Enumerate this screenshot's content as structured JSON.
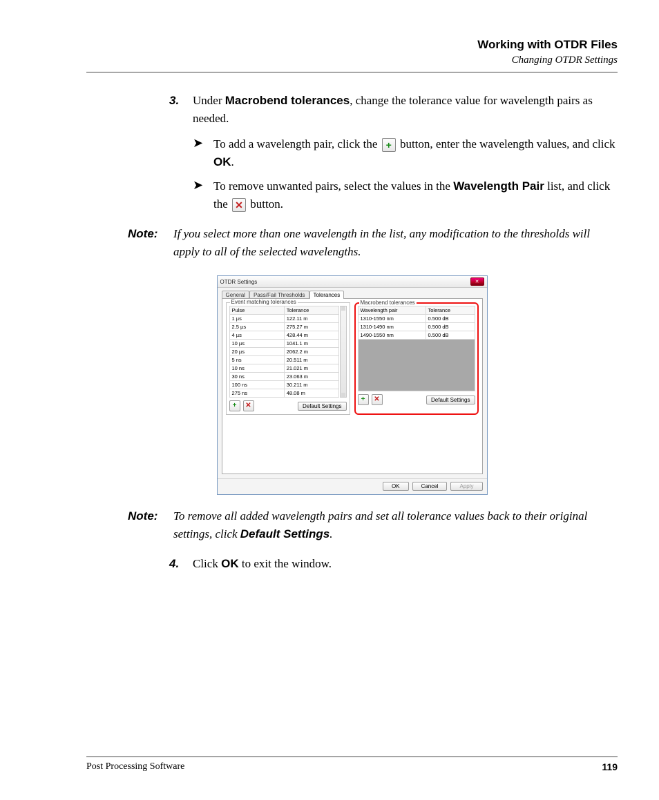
{
  "header": {
    "chapter": "Working with OTDR Files",
    "section": "Changing OTDR Settings"
  },
  "step3": {
    "num": "3.",
    "pre": "Under ",
    "bold1": "Macrobend tolerances",
    "post": ", change the tolerance value for wavelength pairs as needed."
  },
  "bullet1": {
    "a": "To add a wavelength pair, click the ",
    "b": " button, enter the wavelength values, and click ",
    "ok": "OK",
    "c": "."
  },
  "bullet2": {
    "a": "To remove unwanted pairs, select the values in the ",
    "wp": "Wavelength Pair",
    "b": " list, and click the ",
    "c": " button."
  },
  "note1": {
    "label": "Note:",
    "text": "If you select more than one wavelength in the list, any modification to the thresholds will apply to all of the selected wavelengths."
  },
  "dialog": {
    "title": "OTDR Settings",
    "tabs": {
      "general": "General",
      "passfail": "Pass/Fail Thresholds",
      "tolerances": "Tolerances"
    },
    "group1": {
      "title": "Event matching tolerances",
      "col1": "Pulse",
      "col2": "Tolerance",
      "rows": [
        {
          "pulse": "1 µs",
          "tol": "122.11 m"
        },
        {
          "pulse": "2.5 µs",
          "tol": "275.27 m"
        },
        {
          "pulse": "4 µs",
          "tol": "428.44 m"
        },
        {
          "pulse": "10 µs",
          "tol": "1041.1 m"
        },
        {
          "pulse": "20 µs",
          "tol": "2062.2 m"
        },
        {
          "pulse": "5 ns",
          "tol": "20.511 m"
        },
        {
          "pulse": "10 ns",
          "tol": "21.021 m"
        },
        {
          "pulse": "30 ns",
          "tol": "23.063 m"
        },
        {
          "pulse": "100 ns",
          "tol": "30.211 m"
        },
        {
          "pulse": "275 ns",
          "tol": "48.08 m"
        }
      ],
      "defaults": "Default Settings"
    },
    "group2": {
      "title": "Macrobend tolerances",
      "col1": "Wavelength pair",
      "col2": "Tolerance",
      "rows": [
        {
          "wl": "1310-1550 nm",
          "tol": "0.500 dB"
        },
        {
          "wl": "1310-1490 nm",
          "tol": "0.500 dB"
        },
        {
          "wl": "1490-1550 nm",
          "tol": "0.500 dB"
        }
      ],
      "defaults": "Default Settings"
    },
    "buttons": {
      "ok": "OK",
      "cancel": "Cancel",
      "apply": "Apply"
    }
  },
  "note2": {
    "label": "Note:",
    "a": "To remove all added wavelength pairs and set all tolerance values back to their original settings, click ",
    "b": "Default Settings",
    "c": "."
  },
  "step4": {
    "num": "4.",
    "a": "Click ",
    "ok": "OK",
    "b": " to exit the window."
  },
  "footer": {
    "product": "Post Processing Software",
    "page": "119"
  },
  "icons": {
    "plus": "+",
    "x": "✕"
  }
}
